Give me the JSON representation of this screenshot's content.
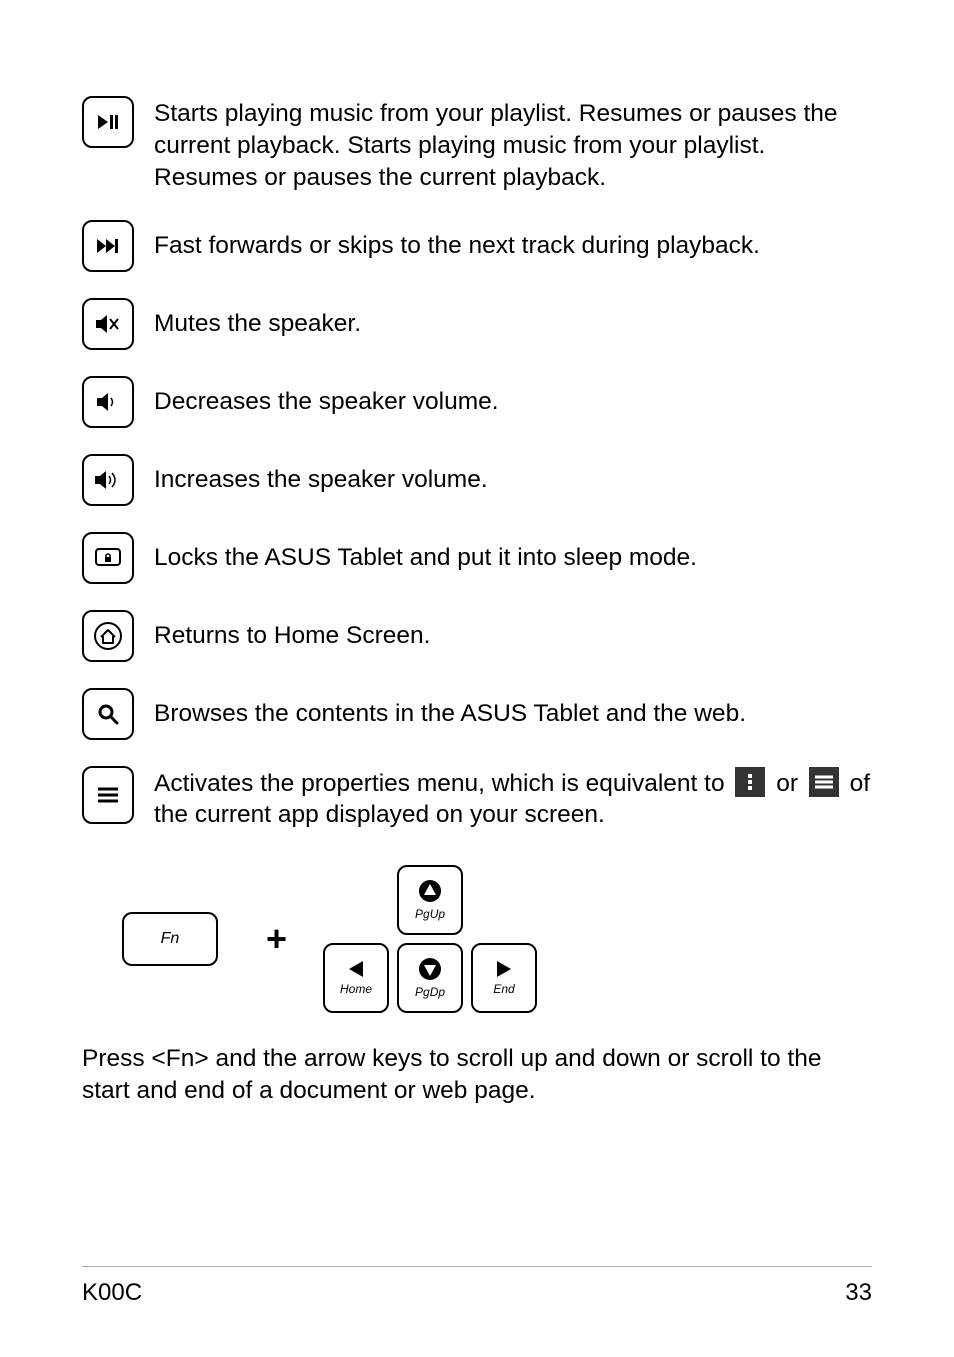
{
  "keys": [
    {
      "id": "play-pause",
      "desc": "Starts playing music from your playlist. Resumes or pauses the current playback. Starts playing music from your playlist. Resumes or pauses the current playback."
    },
    {
      "id": "next-track",
      "desc": "Fast forwards or skips to the next track during playback."
    },
    {
      "id": "mute",
      "desc": "Mutes the speaker."
    },
    {
      "id": "vol-down",
      "desc": "Decreases the speaker volume."
    },
    {
      "id": "vol-up",
      "desc": "Increases the speaker volume."
    },
    {
      "id": "lock",
      "desc": "Locks the ASUS Tablet and put it into sleep mode."
    },
    {
      "id": "home",
      "desc": "Returns to Home Screen."
    },
    {
      "id": "search",
      "desc": "Browses the contents in the ASUS Tablet and the web."
    }
  ],
  "menu_key": {
    "before": "Activates the properties menu, which is equivalent to ",
    "middle": " or ",
    "after": " of the current app displayed on your screen."
  },
  "fn": {
    "label": "Fn",
    "arrows": {
      "up": "PgUp",
      "down": "PgDp",
      "left": "Home",
      "right": "End"
    },
    "text": "Press <Fn> and the arrow keys to scroll up and down or scroll to the start and end of a document or web page."
  },
  "footer": {
    "model": "K00C",
    "page": "33"
  }
}
